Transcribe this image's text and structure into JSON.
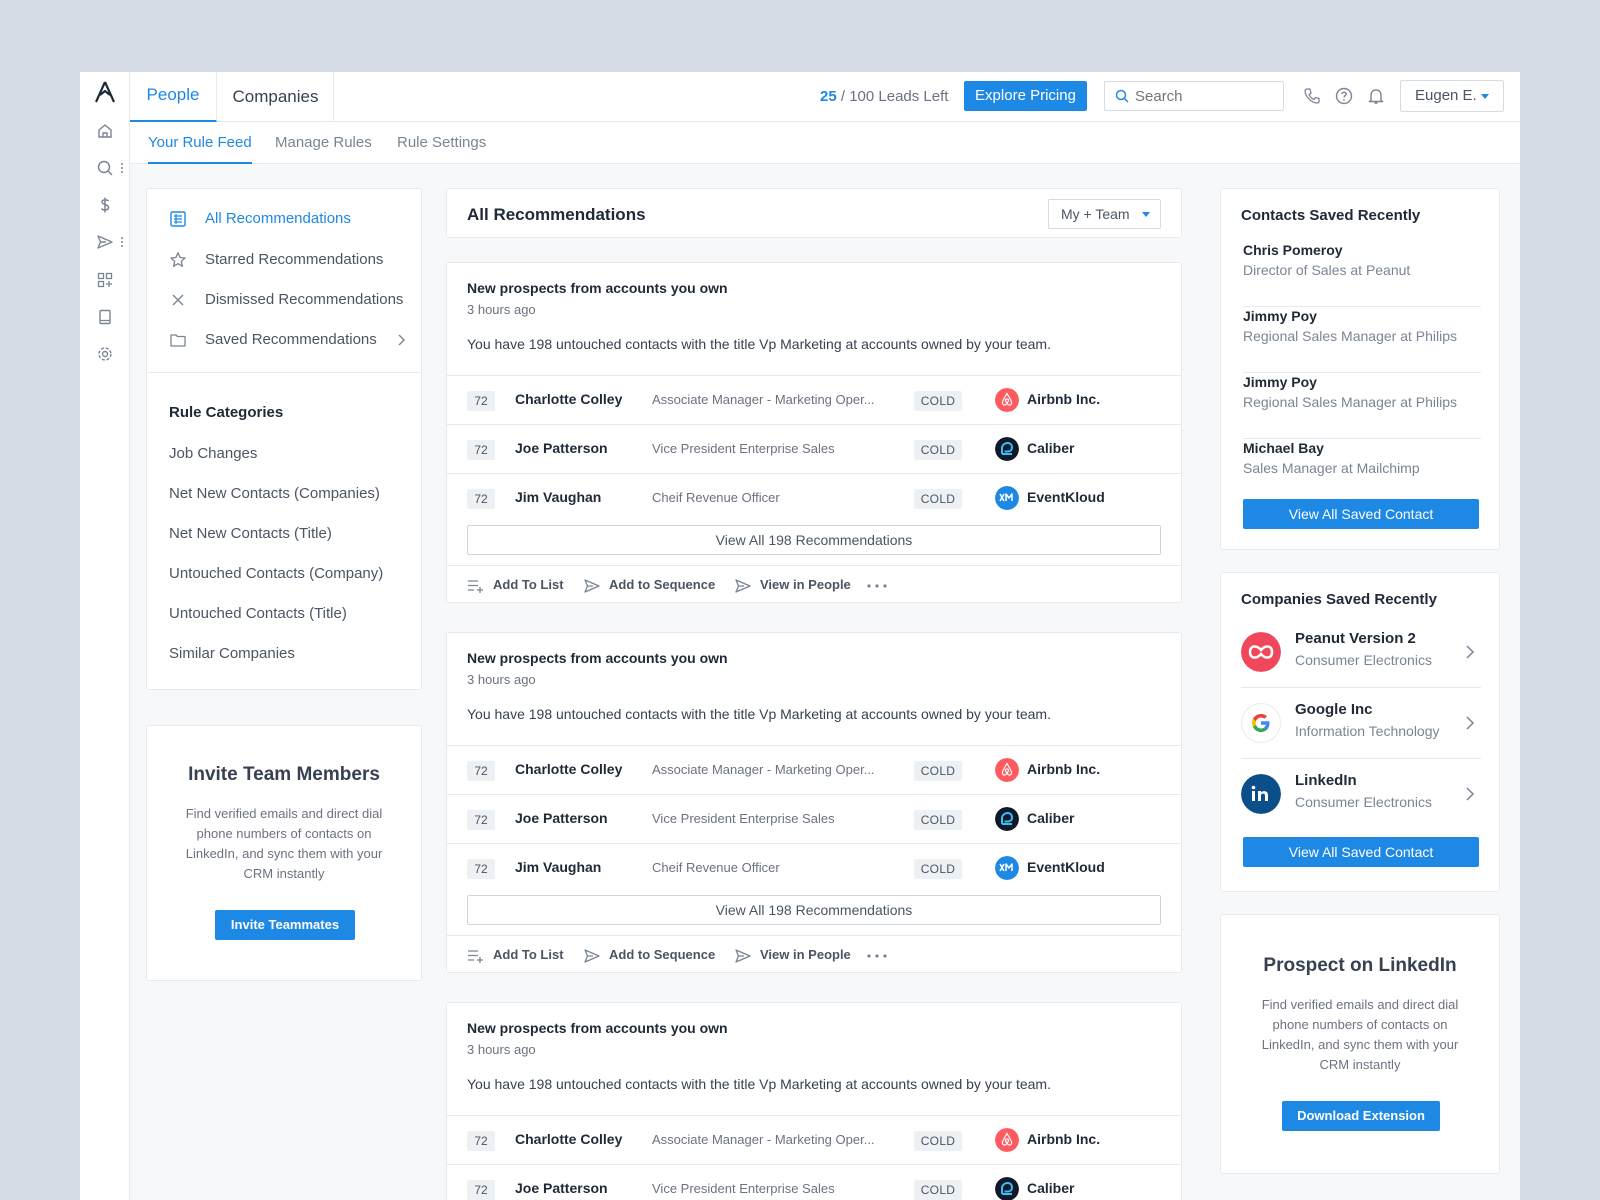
{
  "topbar": {
    "tabs": [
      {
        "label": "People"
      },
      {
        "label": "Companies"
      }
    ],
    "leads_used": "25",
    "leads_rest": " / 100 Leads Left",
    "pricing_button": "Explore Pricing",
    "search_placeholder": "Search",
    "user_name": "Eugen E."
  },
  "subtabs": [
    {
      "label": "Your Rule Feed"
    },
    {
      "label": "Manage Rules"
    },
    {
      "label": "Rule Settings"
    }
  ],
  "left": {
    "nav": [
      {
        "label": "All Recommendations",
        "icon": "list-icon"
      },
      {
        "label": "Starred Recommendations",
        "icon": "star-icon"
      },
      {
        "label": "Dismissed Recommendations",
        "icon": "close-icon"
      },
      {
        "label": "Saved Recommendations",
        "icon": "folder-icon"
      }
    ],
    "categories_title": "Rule Categories",
    "categories": [
      "Job Changes",
      "Net New Contacts (Companies)",
      "Net New Contacts (Title)",
      "Untouched Contacts (Company)",
      "Untouched Contacts (Title)",
      "Similar Companies"
    ],
    "invite": {
      "title": "Invite Team Members",
      "text": "Find verified emails and direct dial phone numbers of contacts on LinkedIn, and sync them with your CRM instantly",
      "button": "Invite Teammates"
    }
  },
  "center": {
    "header_title": "All Recommendations",
    "filter_value": "My + Team",
    "recommendations": [
      {
        "title": "New prospects from accounts you own",
        "time": "3 hours ago",
        "description": "You have 198 untouched contacts with the title Vp Marketing at accounts owned by your team.",
        "rows": [
          {
            "score": "72",
            "name": "Charlotte Colley",
            "title": "Associate Manager - Marketing Oper...",
            "status": "COLD",
            "company": "Airbnb Inc.",
            "logo": "airbnb"
          },
          {
            "score": "72",
            "name": "Joe Patterson",
            "title": "Vice President Enterprise Sales",
            "status": "COLD",
            "company": "Caliber",
            "logo": "caliber"
          },
          {
            "score": "72",
            "name": "Jim Vaughan",
            "title": "Cheif Revenue Officer",
            "status": "COLD",
            "company": "EventKloud",
            "logo": "eventkloud"
          }
        ],
        "view_all": "View All 198 Recommendations",
        "actions": [
          "Add To List",
          "Add to Sequence",
          "View in People"
        ]
      },
      {
        "title": "New prospects from accounts you own",
        "time": "3 hours ago",
        "description": "You have 198 untouched contacts with the title Vp Marketing at accounts owned by your team.",
        "rows": [
          {
            "score": "72",
            "name": "Charlotte Colley",
            "title": "Associate Manager - Marketing Oper...",
            "status": "COLD",
            "company": "Airbnb Inc.",
            "logo": "airbnb"
          },
          {
            "score": "72",
            "name": "Joe Patterson",
            "title": "Vice President Enterprise Sales",
            "status": "COLD",
            "company": "Caliber",
            "logo": "caliber"
          },
          {
            "score": "72",
            "name": "Jim Vaughan",
            "title": "Cheif Revenue Officer",
            "status": "COLD",
            "company": "EventKloud",
            "logo": "eventkloud"
          }
        ],
        "view_all": "View All 198 Recommendations",
        "actions": [
          "Add To List",
          "Add to Sequence",
          "View in People"
        ]
      },
      {
        "title": "New prospects from accounts you own",
        "time": "3 hours ago",
        "description": "You have 198 untouched contacts with the title Vp Marketing at accounts owned by your team.",
        "rows": [
          {
            "score": "72",
            "name": "Charlotte Colley",
            "title": "Associate Manager - Marketing Oper...",
            "status": "COLD",
            "company": "Airbnb Inc.",
            "logo": "airbnb"
          },
          {
            "score": "72",
            "name": "Joe Patterson",
            "title": "Vice President Enterprise Sales",
            "status": "COLD",
            "company": "Caliber",
            "logo": "caliber"
          }
        ]
      }
    ]
  },
  "right": {
    "contacts_title": "Contacts Saved Recently",
    "contacts": [
      {
        "name": "Chris Pomeroy",
        "title": "Director of Sales at Peanut"
      },
      {
        "name": "Jimmy Poy",
        "title": "Regional Sales Manager at Philips"
      },
      {
        "name": "Jimmy Poy",
        "title": "Regional Sales Manager at Philips"
      },
      {
        "name": "Michael Bay",
        "title": "Sales Manager at Mailchimp"
      }
    ],
    "contacts_button": "View All Saved Contact",
    "companies_title": "Companies Saved Recently",
    "companies": [
      {
        "name": "Peanut Version 2",
        "industry": "Consumer Electronics",
        "logo": "peanut"
      },
      {
        "name": "Google Inc",
        "industry": "Information Technology",
        "logo": "google"
      },
      {
        "name": "LinkedIn",
        "industry": "Consumer Electronics",
        "logo": "linkedin"
      }
    ],
    "companies_button": "View All Saved Contact",
    "linkedin": {
      "title": "Prospect on LinkedIn",
      "text": "Find verified emails and direct dial phone numbers of contacts on LinkedIn, and sync them with your CRM instantly",
      "button": "Download Extension"
    }
  },
  "colors": {
    "accent": "#1e88e5",
    "airbnb": "#ff5a5f",
    "eventkloud": "#1e88e5",
    "peanut": "#f0475a",
    "linkedin": "#0a4f8a"
  }
}
